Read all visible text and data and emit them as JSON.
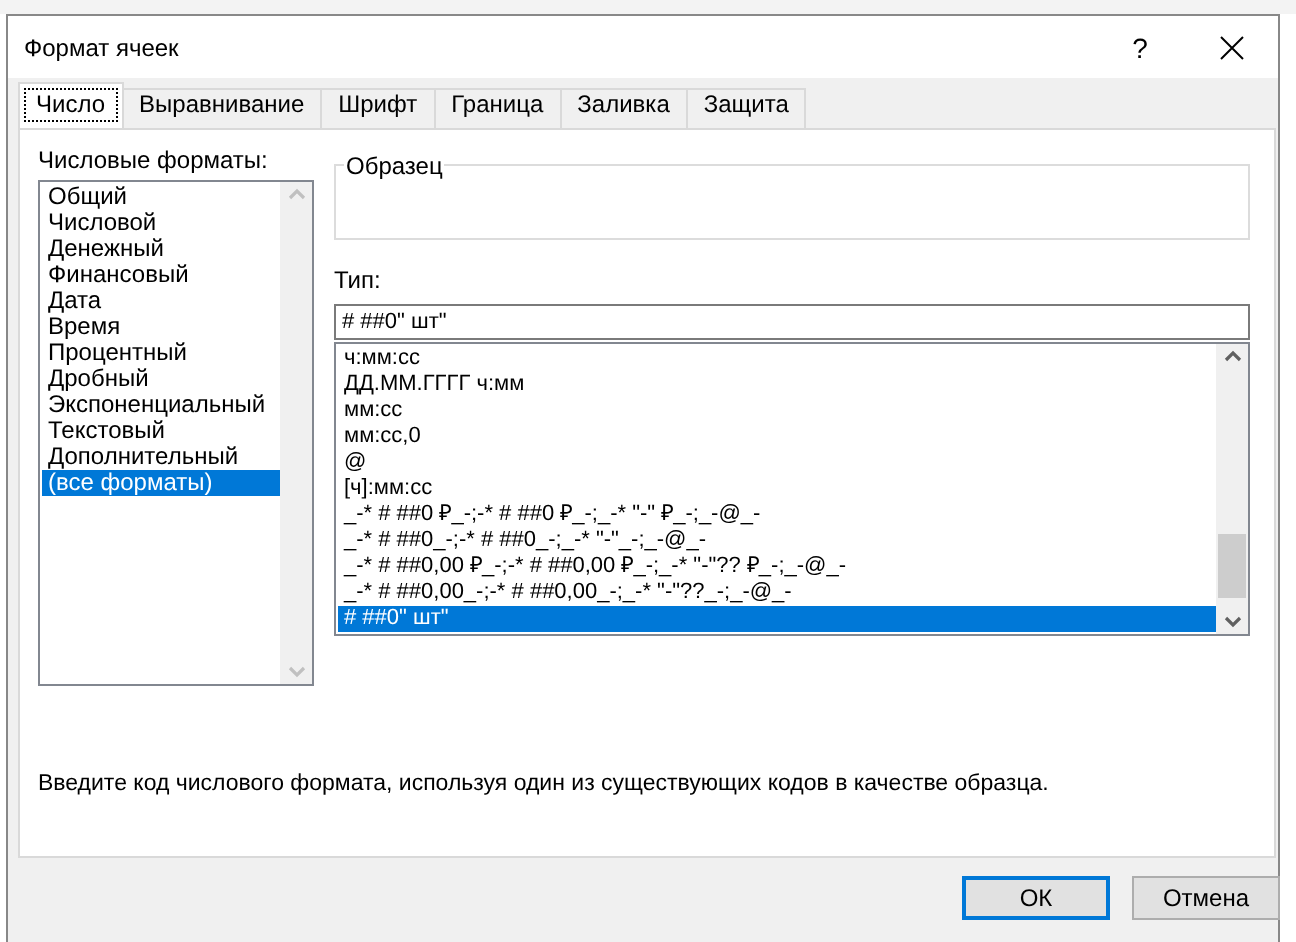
{
  "window": {
    "title": "Формат ячеек",
    "help": "?"
  },
  "tabs": [
    {
      "label": "Число",
      "selected": true
    },
    {
      "label": "Выравнивание",
      "selected": false
    },
    {
      "label": "Шрифт",
      "selected": false
    },
    {
      "label": "Граница",
      "selected": false
    },
    {
      "label": "Заливка",
      "selected": false
    },
    {
      "label": "Защита",
      "selected": false
    }
  ],
  "number_formats": {
    "label": "Числовые форматы:",
    "items": [
      {
        "label": "Общий",
        "selected": false
      },
      {
        "label": "Числовой",
        "selected": false
      },
      {
        "label": "Денежный",
        "selected": false
      },
      {
        "label": "Финансовый",
        "selected": false
      },
      {
        "label": "Дата",
        "selected": false
      },
      {
        "label": "Время",
        "selected": false
      },
      {
        "label": "Процентный",
        "selected": false
      },
      {
        "label": "Дробный",
        "selected": false
      },
      {
        "label": "Экспоненциальный",
        "selected": false
      },
      {
        "label": "Текстовый",
        "selected": false
      },
      {
        "label": "Дополнительный",
        "selected": false
      },
      {
        "label": "(все форматы)",
        "selected": true
      }
    ]
  },
  "sample": {
    "label": "Образец"
  },
  "type": {
    "label": "Тип:",
    "value": "# ##0\" шт\""
  },
  "format_codes": [
    {
      "label": "ч:мм:сс",
      "selected": false
    },
    {
      "label": "ДД.ММ.ГГГГ ч:мм",
      "selected": false
    },
    {
      "label": "мм:сс",
      "selected": false
    },
    {
      "label": "мм:сс,0",
      "selected": false
    },
    {
      "label": "@",
      "selected": false
    },
    {
      "label": "[ч]:мм:сс",
      "selected": false
    },
    {
      "label": "_-* # ##0 ₽_-;-* # ##0 ₽_-;_-* \"-\" ₽_-;_-@_-",
      "selected": false
    },
    {
      "label": "_-* # ##0_-;-* # ##0_-;_-* \"-\"_-;_-@_-",
      "selected": false
    },
    {
      "label": "_-* # ##0,00 ₽_-;-* # ##0,00 ₽_-;_-* \"-\"?? ₽_-;_-@_-",
      "selected": false
    },
    {
      "label": "_-* # ##0,00_-;-* # ##0,00_-;_-* \"-\"??_-;_-@_-",
      "selected": false
    },
    {
      "label": "# ##0\" шт\"",
      "selected": true
    }
  ],
  "hint": "Введите код числового формата, используя один из существующих кодов в качестве образца.",
  "buttons": [
    {
      "label": "ОК",
      "default": true
    },
    {
      "label": "Отмена",
      "default": false
    }
  ]
}
